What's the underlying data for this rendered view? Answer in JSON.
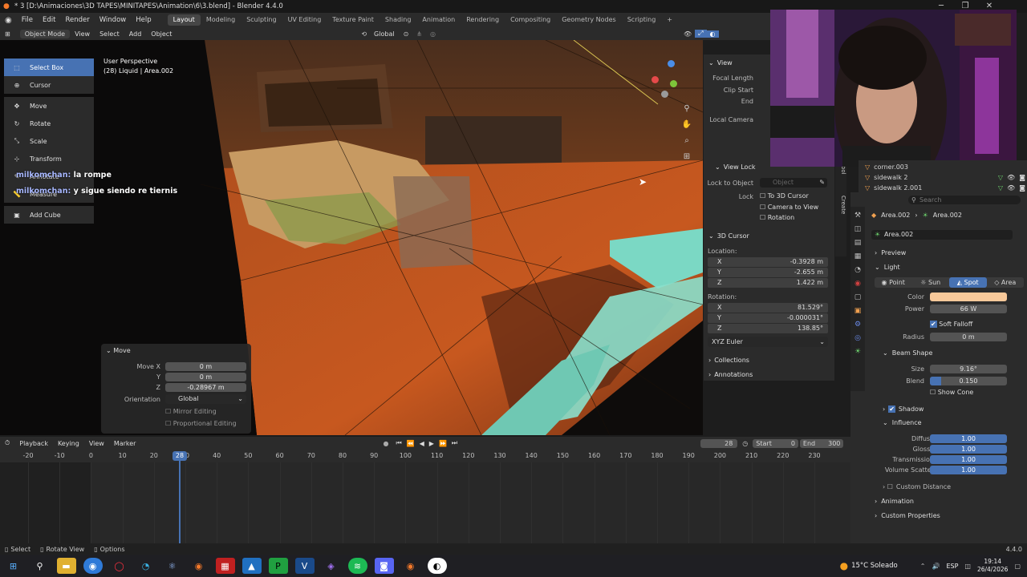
{
  "window": {
    "title": "* 3 [D:\\Animaciones\\3D TAPES\\MINITAPES\\Animation\\6\\3.blend] - Blender 4.4.0",
    "min": "─",
    "max": "❐",
    "close": "✕"
  },
  "menus": [
    "File",
    "Edit",
    "Render",
    "Window",
    "Help"
  ],
  "workspaces": [
    "Layout",
    "Modeling",
    "Sculpting",
    "UV Editing",
    "Texture Paint",
    "Shading",
    "Animation",
    "Rendering",
    "Compositing",
    "Geometry Nodes",
    "Scripting"
  ],
  "viewport_header": {
    "mode": "Object Mode",
    "menus": [
      "View",
      "Select",
      "Add",
      "Object"
    ],
    "orientation": "Global"
  },
  "overlay": {
    "perspective": "User Perspective",
    "object_info": "(28) Liquid | Area.002"
  },
  "tools": [
    "Select Box",
    "Cursor",
    "Move",
    "Rotate",
    "Scale",
    "Transform",
    "Annotate",
    "Measure",
    "Add Cube"
  ],
  "chat": [
    {
      "user": "milkomchan:",
      "msg": "la rompe"
    },
    {
      "user": "milkomchan:",
      "msg": "y sigue siendo re tiernis"
    }
  ],
  "move_panel": {
    "title": "Move",
    "labels": {
      "x": "Move X",
      "y": "Y",
      "z": "Z",
      "orientation": "Orientation"
    },
    "x": "0 m",
    "y": "0 m",
    "z": "-0.28967 m",
    "orientation": "Global",
    "mirror": "Mirror Editing",
    "proportional": "Proportional Editing"
  },
  "npanel": {
    "view_title": "View",
    "focal_length": "Focal Length",
    "clip_start": "Clip Start",
    "clip_end": "End",
    "local_camera": "Local Camera",
    "view_lock": "View Lock",
    "lock_to_object": "Lock to Object",
    "object_placeholder": "Object",
    "lock": "Lock",
    "to_3d_cursor": "To 3D Cursor",
    "camera_to_view": "Camera to View",
    "rotation_lock": "Rotation",
    "cursor_title": "3D Cursor",
    "location": "Location:",
    "loc_x": "-0.3928 m",
    "loc_y": "-2.655 m",
    "loc_z": "1.422 m",
    "rotation": "Rotation:",
    "rot_x": "81.529°",
    "rot_y": "-0.000031°",
    "rot_z": "138.85°",
    "euler": "XYZ Euler",
    "collections": "Collections",
    "annotations": "Annotations",
    "axis_x": "X",
    "axis_y": "Y",
    "axis_z": "Z",
    "tabs": [
      "Tool",
      "Create"
    ]
  },
  "outliner": [
    {
      "name": "corner.003"
    },
    {
      "name": "sidewalk 2"
    },
    {
      "name": "sidewalk 2.001"
    }
  ],
  "props": {
    "search_placeholder": "Search",
    "breadcrumb_1": "Area.002",
    "breadcrumb_2": "Area.002",
    "datablock": "Area.002",
    "preview": "Preview",
    "light": "Light",
    "light_types": [
      "Point",
      "Sun",
      "Spot",
      "Area"
    ],
    "active_type": "Spot",
    "color_label": "Color",
    "color": "#f8c99a",
    "power_label": "Power",
    "power": "66 W",
    "soft_falloff": "Soft Falloff",
    "radius_label": "Radius",
    "radius": "0 m",
    "beam_shape": "Beam Shape",
    "size_label": "Size",
    "size": "9.16°",
    "blend_label": "Blend",
    "blend": "0.150",
    "show_cone": "Show Cone",
    "shadow": "Shadow",
    "influence": "Influence",
    "diffuse_label": "Diffuse",
    "diffuse": "1.00",
    "glossy_label": "Glossy",
    "glossy": "1.00",
    "transmission_label": "Transmission",
    "transmission": "1.00",
    "volume_label": "Volume Scatter",
    "volume": "1.00",
    "custom_distance": "Custom Distance",
    "animation": "Animation",
    "custom_props": "Custom Properties"
  },
  "timeline": {
    "menus": [
      "Playback",
      "Keying",
      "View",
      "Marker"
    ],
    "current_frame": "28",
    "start_label": "Start",
    "start": "0",
    "end_label": "End",
    "end": "300",
    "ticks": [
      "-20",
      "-10",
      "0",
      "10",
      "20",
      "30",
      "40",
      "50",
      "60",
      "70",
      "80",
      "90",
      "100",
      "110",
      "120",
      "130",
      "140",
      "150",
      "160",
      "170",
      "180",
      "190",
      "200",
      "210",
      "220",
      "230"
    ]
  },
  "status": {
    "select": "Select",
    "rotate": "Rotate View",
    "options": "Options",
    "version": "4.4.0"
  },
  "taskbar": {
    "weather": "15°C Soleado",
    "lang": "ESP",
    "time": "19:14",
    "date": "26/4/2026"
  }
}
